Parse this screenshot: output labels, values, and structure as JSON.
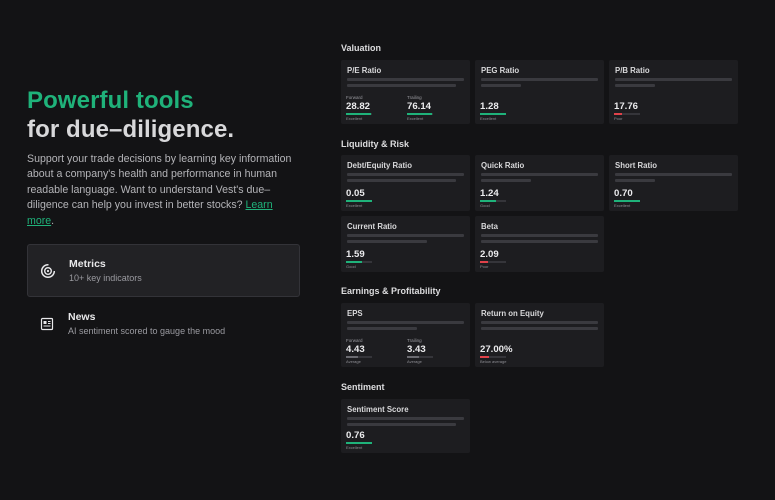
{
  "hero": {
    "title_accent": "Powerful tools",
    "title_rest": "for due–diligence.",
    "description": "Support your trade decisions by learning key information about a company's health and performance in human readable language. Want to understand Vest's due–diligence can help you invest in better stocks?",
    "link": "Learn more",
    "period": "."
  },
  "features": [
    {
      "title": "Metrics",
      "subtitle": "10+ key indicators",
      "icon": "target-icon",
      "active": true
    },
    {
      "title": "News",
      "subtitle": "AI sentiment scored to gauge the mood",
      "icon": "newspaper-icon",
      "active": false
    }
  ],
  "colors": {
    "accent": "#1fb27a",
    "red": "#e0424a",
    "grey": "#6a6a70"
  },
  "sections": {
    "valuation": "Valuation",
    "liquidity": "Liquidity & Risk",
    "earnings": "Earnings & Profitability",
    "sentiment": "Sentiment"
  },
  "cards": {
    "pe": {
      "title": "P/E Ratio",
      "forward": {
        "label": "Forward",
        "value": "28.82",
        "note": "Excellent",
        "fill": 0.95,
        "color": "green"
      },
      "trailing": {
        "label": "Trailing",
        "value": "76.14",
        "note": "Excellent",
        "fill": 0.95,
        "color": "green"
      }
    },
    "peg": {
      "title": "PEG Ratio",
      "value": "1.28",
      "note": "Excellent",
      "fill": 1.0,
      "color": "green"
    },
    "pb": {
      "title": "P/B Ratio",
      "value": "17.76",
      "note": "Poor",
      "fill": 0.3,
      "color": "red"
    },
    "de": {
      "title": "Debt/Equity Ratio",
      "value": "0.05",
      "note": "Excellent",
      "fill": 1.0,
      "color": "green"
    },
    "quick": {
      "title": "Quick Ratio",
      "value": "1.24",
      "note": "Good",
      "fill": 0.6,
      "color": "green"
    },
    "short": {
      "title": "Short Ratio",
      "value": "0.70",
      "note": "Excellent",
      "fill": 1.0,
      "color": "green"
    },
    "current": {
      "title": "Current Ratio",
      "value": "1.59",
      "note": "Good",
      "fill": 0.6,
      "color": "green"
    },
    "beta": {
      "title": "Beta",
      "value": "2.09",
      "note": "Poor",
      "fill": 0.3,
      "color": "red"
    },
    "eps": {
      "title": "EPS",
      "forward": {
        "label": "Forward",
        "value": "4.43",
        "note": "Average",
        "fill": 0.45,
        "color": "grey"
      },
      "trailing": {
        "label": "Trailing",
        "value": "3.43",
        "note": "Average",
        "fill": 0.45,
        "color": "grey"
      }
    },
    "roe": {
      "title": "Return on Equity",
      "value": "27.00%",
      "note": "Below average",
      "fill": 0.35,
      "color": "red"
    },
    "sent": {
      "title": "Sentiment Score",
      "value": "0.76",
      "note": "Excellent",
      "fill": 1.0,
      "color": "green"
    }
  }
}
